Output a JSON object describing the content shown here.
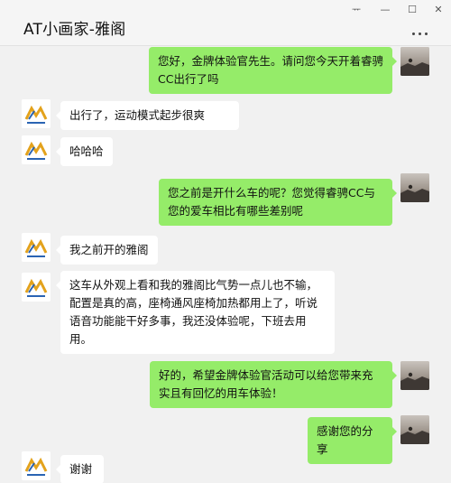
{
  "window": {
    "title": "AT小画家-雅阁",
    "controls": {
      "pin": "ᅲ",
      "minimize": "—",
      "maximize": "☐",
      "close": "✕"
    }
  },
  "colors": {
    "outgoing_bubble": "#95ec69",
    "incoming_bubble": "#ffffff",
    "background": "#f1f1f1"
  },
  "messages": [
    {
      "side": "out",
      "text": "您好，金牌体验官先生。请问您今天开着睿骋CC出行了吗"
    },
    {
      "side": "in",
      "text": "出行了，运动模式起步很爽"
    },
    {
      "side": "in",
      "text": "哈哈哈"
    },
    {
      "side": "out",
      "text": "您之前是开什么车的呢？您觉得睿骋CC与您的爱车相比有哪些差别呢"
    },
    {
      "side": "in",
      "text": "我之前开的雅阁"
    },
    {
      "side": "in",
      "text": "这车从外观上看和我的雅阁比气势一点儿也不输，配置是真的高，座椅通风座椅加热都用上了，听说语音功能能干好多事，我还没体验呢，下班去用用。"
    },
    {
      "side": "out",
      "text": "好的，希望金牌体验官活动可以给您带来充实且有回忆的用车体验！"
    },
    {
      "side": "out",
      "text": "感谢您的分享"
    },
    {
      "side": "in",
      "text": "谢谢"
    }
  ]
}
